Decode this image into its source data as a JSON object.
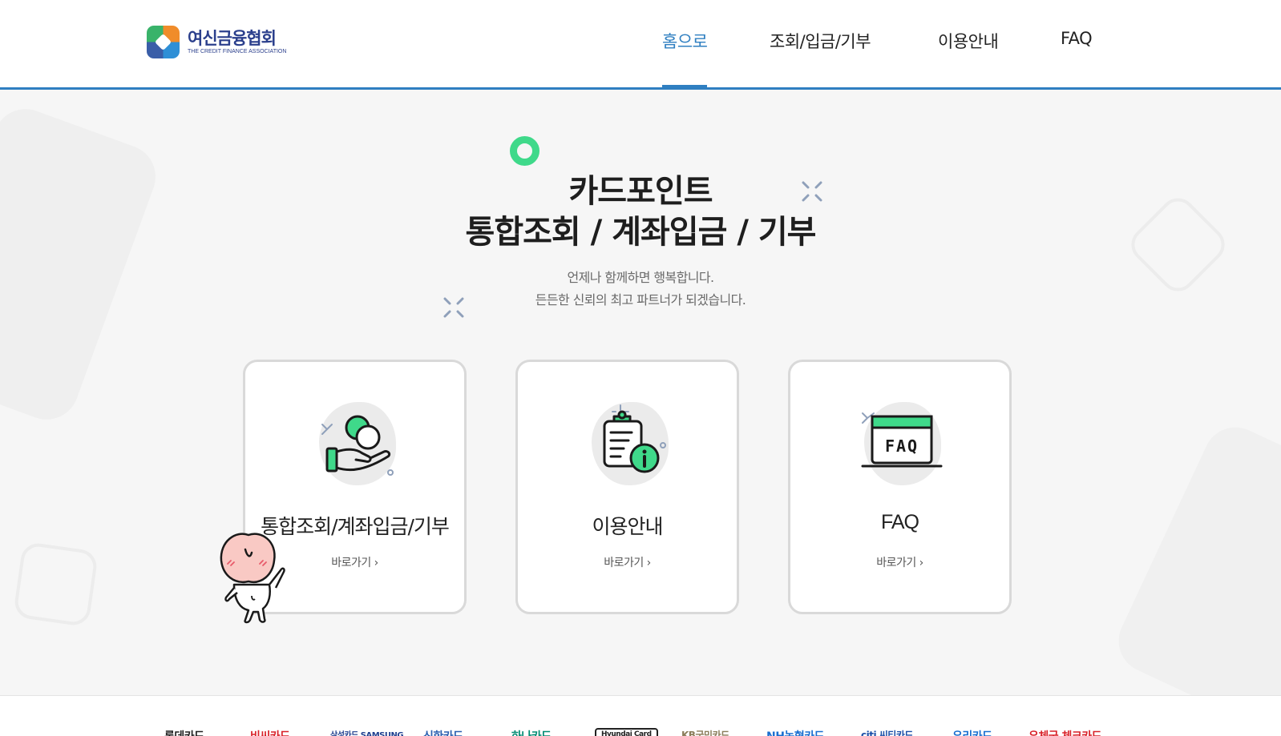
{
  "header": {
    "logo": {
      "name_kr": "여신금융협회",
      "name_en": "THE CREDIT FINANCE ASSOCIATION"
    },
    "nav": [
      {
        "label": "홈으로",
        "active": true
      },
      {
        "label": "조회/입금/기부",
        "active": false
      },
      {
        "label": "이용안내",
        "active": false
      },
      {
        "label": "FAQ",
        "active": false
      }
    ],
    "accent_color": "#2f7fc1"
  },
  "hero": {
    "title_line1": "카드포인트",
    "title_line2": "통합조회 / 계좌입금 / 기부",
    "subtitle_line1": "언제나 함께하면 행복합니다.",
    "subtitle_line2": "든든한 신뢰의 최고 파트너가 되겠습니다."
  },
  "cards": [
    {
      "title": "통합조회/계좌입금/기부",
      "link": "바로가기 ›",
      "icon": "coin-hand-icon"
    },
    {
      "title": "이용안내",
      "link": "바로가기 ›",
      "icon": "clipboard-info-icon"
    },
    {
      "title": "FAQ",
      "link": "바로가기 ›",
      "icon": "faq-window-icon",
      "icon_text": "FAQ"
    }
  ],
  "icon_accent": "#3fd98a",
  "partners": [
    {
      "label": "롯데카드",
      "color": "#222222"
    },
    {
      "label": "비씨카드",
      "color": "#d9222a"
    },
    {
      "label": "삼성카드 SAMSUNG",
      "color": "#1f3f8f"
    },
    {
      "label": "신한카드",
      "color": "#2b5fb0"
    },
    {
      "label": "하나카드",
      "color": "#008c73"
    },
    {
      "label": "Hyundai Card",
      "color": "#222222"
    },
    {
      "label": "KB국민카드",
      "color": "#8b7d5a"
    },
    {
      "label": "NH농협카드",
      "color": "#1a6fd0"
    },
    {
      "label": "citi 씨티카드",
      "color": "#1a4fa8"
    },
    {
      "label": "우리카드",
      "color": "#1a6fd0"
    },
    {
      "label": "우체국 체크카드",
      "color": "#d9222a"
    }
  ]
}
